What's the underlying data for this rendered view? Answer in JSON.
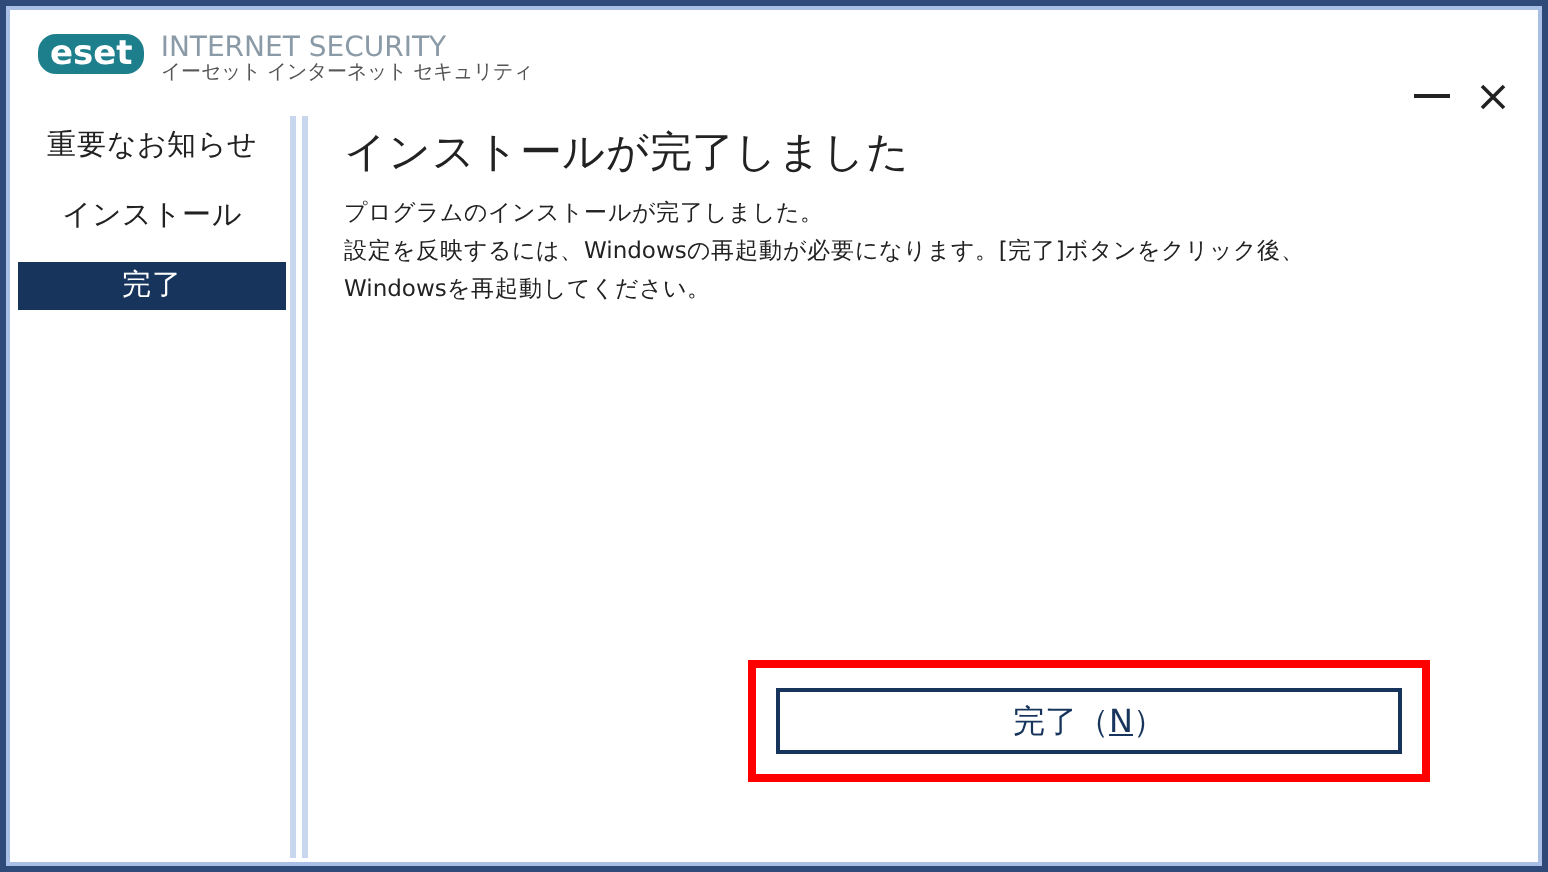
{
  "logo": {
    "mark": "eset",
    "product": "INTERNET SECURITY",
    "product_kana": "イーセット インターネット セキュリティ"
  },
  "sidebar": {
    "items": [
      {
        "label": "重要なお知らせ",
        "selected": false
      },
      {
        "label": "インストール",
        "selected": false
      },
      {
        "label": "完了",
        "selected": true
      }
    ]
  },
  "content": {
    "title": "インストールが完了しました",
    "paragraphs": [
      "プログラムのインストールが完了しました。",
      "設定を反映するには、Windowsの再起動が必要になります。[完了]ボタンをクリック後、",
      "Windowsを再起動してください。"
    ]
  },
  "finish_button": {
    "label_before": "完了（",
    "mnemonic": "N",
    "label_after": "）",
    "highlighted": true
  }
}
